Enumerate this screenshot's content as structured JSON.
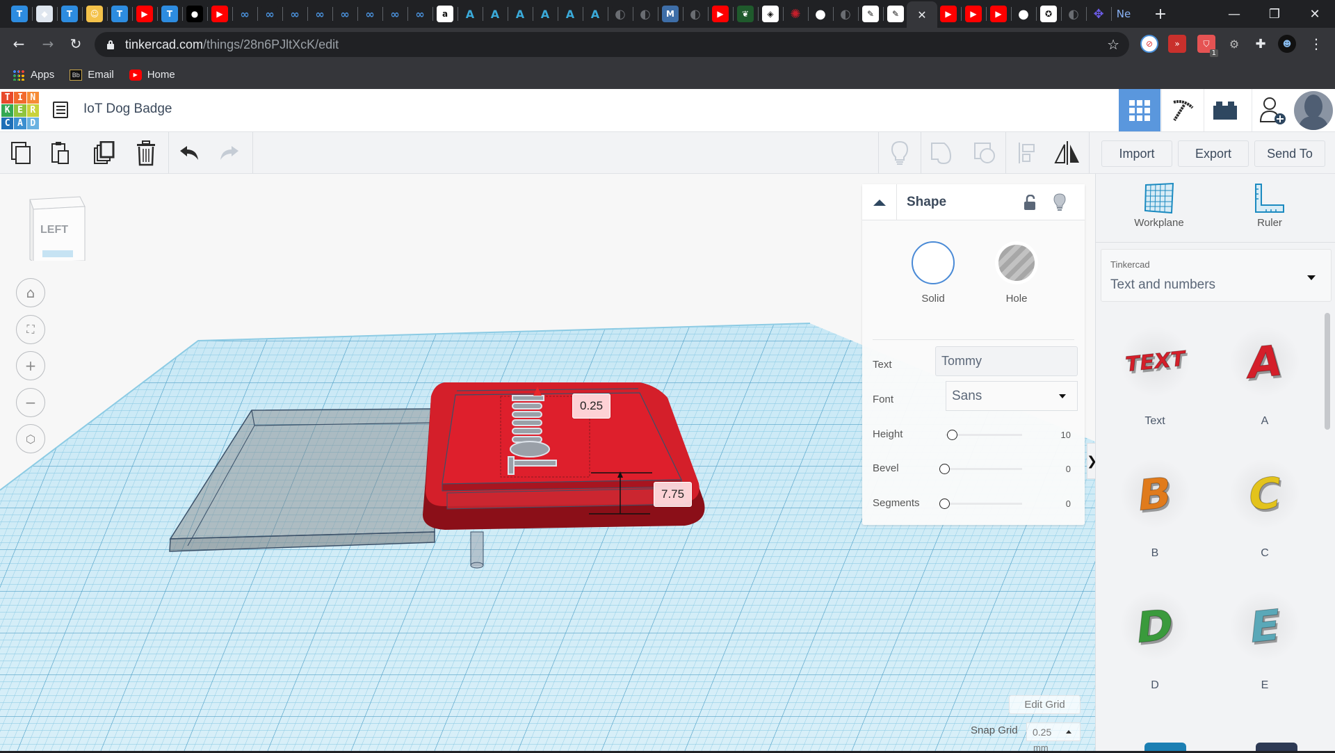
{
  "browser": {
    "tabs": [
      {
        "icon": "tinkercad-t-icon",
        "color": "#2d8ce0",
        "glyph": "T"
      },
      {
        "icon": "app-icon",
        "color": "#dfe6ef",
        "glyph": "◆"
      },
      {
        "icon": "tinkercad-t-icon",
        "color": "#2d8ce0",
        "glyph": "T"
      },
      {
        "icon": "avatar-app-icon",
        "color": "#f4c24a",
        "glyph": "☺"
      },
      {
        "icon": "tinkercad-t-icon",
        "color": "#2d8ce0",
        "glyph": "T"
      },
      {
        "icon": "youtube-icon",
        "color": "#ff0000",
        "glyph": "▶"
      },
      {
        "icon": "tinkercad-t-icon",
        "color": "#2d8ce0",
        "glyph": "T"
      },
      {
        "icon": "medium-icon",
        "color": "#000000",
        "glyph": "●"
      },
      {
        "icon": "youtube-icon",
        "color": "#ff0000",
        "glyph": "▶"
      },
      {
        "icon": "infinity-icon",
        "color": "#202124",
        "glyph": "∞"
      },
      {
        "icon": "infinity-icon",
        "color": "#202124",
        "glyph": "∞"
      },
      {
        "icon": "infinity-icon",
        "color": "#202124",
        "glyph": "∞"
      },
      {
        "icon": "infinity-icon",
        "color": "#202124",
        "glyph": "∞"
      },
      {
        "icon": "infinity-icon",
        "color": "#202124",
        "glyph": "∞"
      },
      {
        "icon": "infinity-icon",
        "color": "#202124",
        "glyph": "∞"
      },
      {
        "icon": "infinity-icon",
        "color": "#202124",
        "glyph": "∞"
      },
      {
        "icon": "infinity-icon",
        "color": "#202124",
        "glyph": "∞"
      },
      {
        "icon": "amazon-icon",
        "color": "#ffffff",
        "glyph": "a"
      },
      {
        "icon": "autodesk-icon",
        "color": "#202124",
        "glyph": "A"
      },
      {
        "icon": "autodesk-icon",
        "color": "#202124",
        "glyph": "A"
      },
      {
        "icon": "autodesk-icon",
        "color": "#202124",
        "glyph": "A"
      },
      {
        "icon": "autodesk-icon",
        "color": "#202124",
        "glyph": "A"
      },
      {
        "icon": "autodesk-icon",
        "color": "#202124",
        "glyph": "A"
      },
      {
        "icon": "autodesk-icon",
        "color": "#202124",
        "glyph": "A"
      },
      {
        "icon": "globe-icon",
        "color": "#202124",
        "glyph": "◐"
      },
      {
        "icon": "globe-icon",
        "color": "#202124",
        "glyph": "◐"
      },
      {
        "icon": "m-logo-icon",
        "color": "#3e6ea8",
        "glyph": "M"
      },
      {
        "icon": "globe-icon",
        "color": "#202124",
        "glyph": "◐"
      },
      {
        "icon": "youtube-icon",
        "color": "#ff0000",
        "glyph": "▶"
      },
      {
        "icon": "dragon-icon",
        "color": "#1f5a2c",
        "glyph": "❦"
      },
      {
        "icon": "badge-icon",
        "color": "#ffffff",
        "glyph": "◈"
      },
      {
        "icon": "microchip-icon",
        "color": "#202124",
        "glyph": "✺"
      },
      {
        "icon": "github-icon",
        "color": "#202124",
        "glyph": "●"
      },
      {
        "icon": "globe-icon",
        "color": "#202124",
        "glyph": "◐"
      },
      {
        "icon": "sketch-icon",
        "color": "#ffffff",
        "glyph": "✎"
      },
      {
        "icon": "sketch-icon",
        "color": "#ffffff",
        "glyph": "✎"
      },
      {
        "icon": "close-tab-icon",
        "color": "#35363a",
        "glyph": "✕",
        "active": true
      },
      {
        "icon": "youtube-icon",
        "color": "#ff0000",
        "glyph": "▶"
      },
      {
        "icon": "youtube-icon",
        "color": "#ff0000",
        "glyph": "▶"
      },
      {
        "icon": "youtube-icon",
        "color": "#ff0000",
        "glyph": "▶"
      },
      {
        "icon": "github-icon",
        "color": "#202124",
        "glyph": "●"
      },
      {
        "icon": "university-icon",
        "color": "#ffffff",
        "glyph": "✪"
      },
      {
        "icon": "globe-icon",
        "color": "#202124",
        "glyph": "◐"
      },
      {
        "icon": "drone-icon",
        "color": "#202124",
        "glyph": "✥"
      },
      {
        "icon": "ne-icon",
        "color": "#202124",
        "glyph": "Ne"
      }
    ],
    "new_tab": "+",
    "window_controls": {
      "minimize": "—",
      "maximize": "❐",
      "close": "✕"
    },
    "url_host": "tinkercad.com",
    "url_path": "/things/28n6PJltXcK/edit",
    "extension_badge": "1",
    "bookmarks": [
      {
        "label": "Apps",
        "icon": "apps-grid-icon"
      },
      {
        "label": "Email",
        "icon": "blackboard-icon"
      },
      {
        "label": "Home",
        "icon": "youtube-icon"
      }
    ]
  },
  "header": {
    "logo_letters": [
      "T",
      "I",
      "N",
      "K",
      "E",
      "R",
      "C",
      "A",
      "D"
    ],
    "logo_colors": [
      "#e8492b",
      "#f26a2e",
      "#f68b36",
      "#34a853",
      "#8fc43d",
      "#c9d23b",
      "#1e6fb7",
      "#3b8fd0",
      "#6ab2e1"
    ],
    "design_title": "IoT Dog Badge",
    "accent": "#5a97dd"
  },
  "toolbar": {
    "import": "Import",
    "export": "Export",
    "send_to": "Send To"
  },
  "viewcube": {
    "face": "LEFT"
  },
  "dimensions": {
    "top": "0.25",
    "height": "7.75"
  },
  "shape_panel": {
    "title": "Shape",
    "solid": "Solid",
    "hole": "Hole",
    "text_label": "Text",
    "text_value": "Tommy",
    "font_label": "Font",
    "font_value": "Sans",
    "sliders": [
      {
        "label": "Height",
        "value": "10",
        "fraction": 0.08
      },
      {
        "label": "Bevel",
        "value": "0",
        "fraction": 0
      },
      {
        "label": "Segments",
        "value": "0",
        "fraction": 0
      }
    ]
  },
  "grid": {
    "edit_grid": "Edit Grid",
    "snap_label": "Snap Grid",
    "snap_value": "0.25",
    "snap_unit": "mm"
  },
  "sidebar": {
    "workplane": "Workplane",
    "ruler": "Ruler",
    "library_source": "Tinkercad",
    "library_category": "Text and numbers",
    "shapes": [
      {
        "name": "Text",
        "color": "#d41f2a"
      },
      {
        "name": "A",
        "color": "#d41f2a"
      },
      {
        "name": "B",
        "color": "#e07b1c"
      },
      {
        "name": "C",
        "color": "#e3c31c"
      },
      {
        "name": "D",
        "color": "#3a9a3c"
      },
      {
        "name": "E",
        "color": "#5aa8b8"
      }
    ]
  }
}
